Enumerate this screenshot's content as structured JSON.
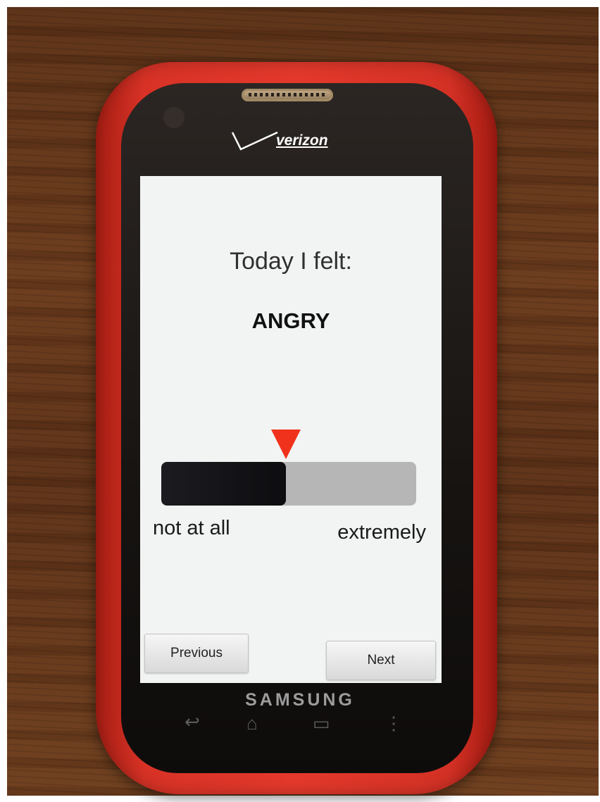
{
  "device": {
    "carrier_logo": "verizon",
    "brand": "SAMSUNG"
  },
  "screen": {
    "prompt": "Today I felt:",
    "emotion": "ANGRY",
    "slider": {
      "value_percent": 49,
      "min_label": "not at all",
      "max_label": "extremely",
      "marker_color": "#f0321c"
    },
    "buttons": {
      "previous": "Previous",
      "next": "Next"
    }
  },
  "hardware_keys": {
    "back_icon": "back-icon",
    "home_icon": "home-icon",
    "recent_icon": "recent-apps-icon",
    "menu_icon": "menu-icon"
  }
}
